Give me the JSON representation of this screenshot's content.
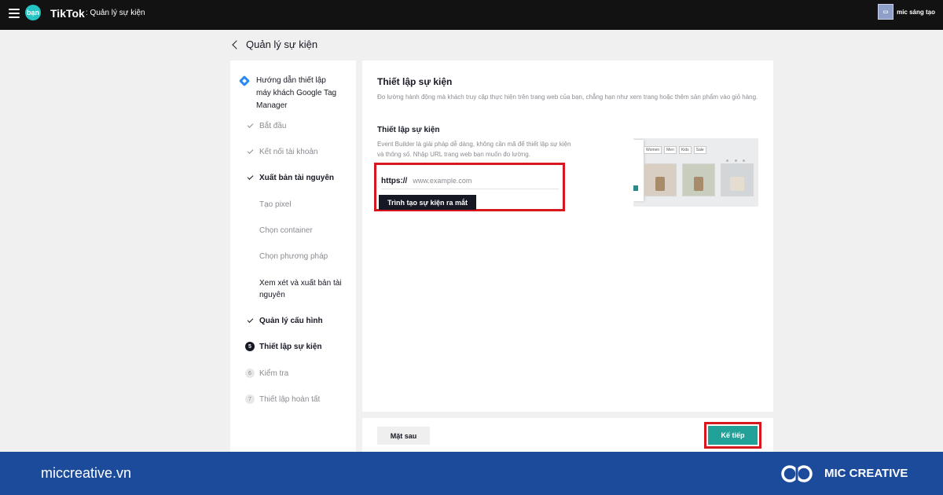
{
  "topbar": {
    "logo_text": "bạn",
    "brand": "TikTok",
    "section": ": Quản lý sự kiện",
    "account_name": "mic sáng tạo"
  },
  "page": {
    "title": "Quản lý sự kiện"
  },
  "sidebar": {
    "guide": "Hướng dẫn thiết lập máy khách Google Tag Manager",
    "steps": [
      {
        "label": "Bắt đầu",
        "state": "done-muted"
      },
      {
        "label": "Kết nối tài khoản",
        "state": "done-muted"
      },
      {
        "label": "Xuất bản tài nguyên",
        "state": "done"
      },
      {
        "label": "Tạo pixel",
        "state": "substep-muted"
      },
      {
        "label": "Chọn container",
        "state": "substep-muted"
      },
      {
        "label": "Chọn phương pháp",
        "state": "substep-muted"
      },
      {
        "label": "Xem xét và xuất bản tài nguyên",
        "state": "substep"
      },
      {
        "label": "Quản lý cấu hình",
        "state": "done"
      },
      {
        "label": "Thiết lập sự kiện",
        "state": "active",
        "number": "5"
      },
      {
        "label": "Kiểm tra",
        "state": "pending",
        "number": "6"
      },
      {
        "label": "Thiết lập hoàn tất",
        "state": "pending",
        "number": "7"
      }
    ]
  },
  "main": {
    "title": "Thiết lập sự kiện",
    "description": "Đo lường hành động mà khách truy cập thực hiện trên trang web của bạn, chẳng hạn như xem trang hoặc thêm sản phẩm vào giỏ hàng.",
    "section_title": "Thiết lập sự kiện",
    "section_description": "Event Builder là giải pháp dễ dàng, không cần mã để thiết lập sự kiện và thông số. Nhập URL trang web bạn muốn đo lường.",
    "url_prefix": "https://",
    "url_placeholder": "www.example.com",
    "builder_button": "Trình tạo sự kiện ra mắt",
    "preview": {
      "nav": [
        "Women",
        "Men",
        "Kids",
        "Sale"
      ]
    }
  },
  "actions": {
    "back": "Mặt sau",
    "next": "Kế tiếp"
  },
  "footer": {
    "site": "miccreative.vn",
    "brand": "MIC CREATIVE"
  },
  "colors": {
    "highlight": "#d8161d",
    "primary_button": "#21a198",
    "footer": "#1d4b9c"
  }
}
